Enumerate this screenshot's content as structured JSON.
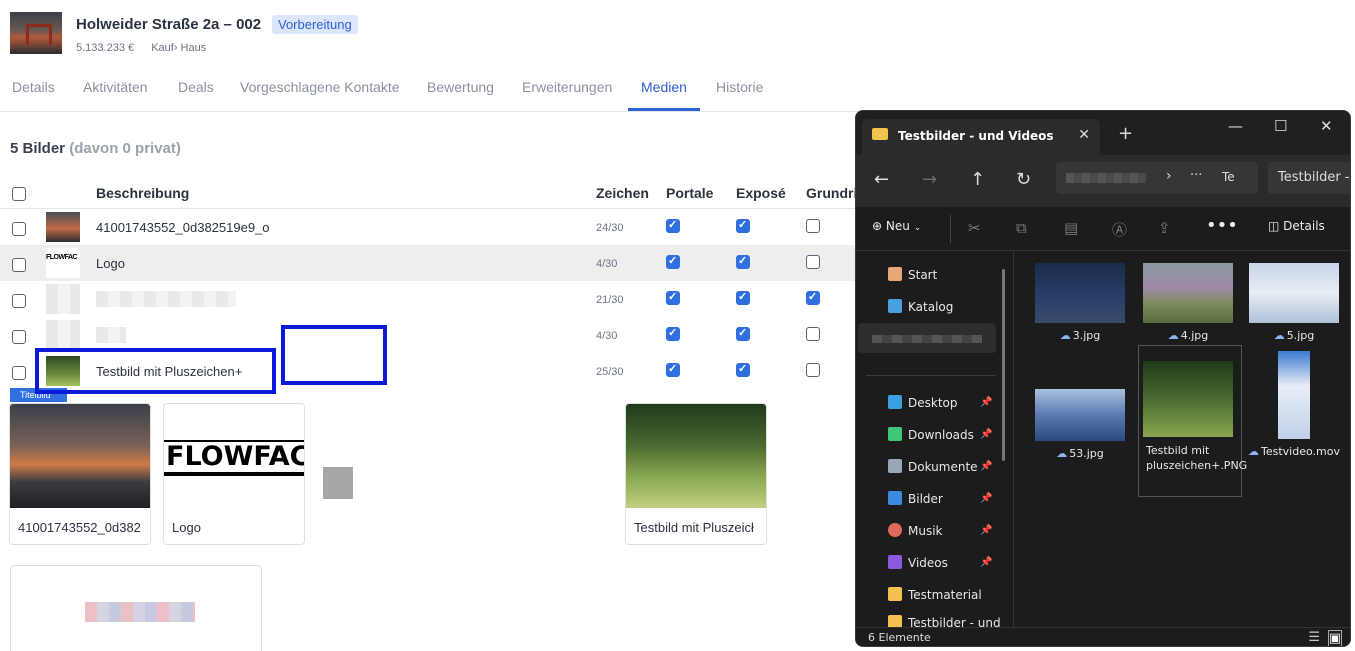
{
  "header": {
    "title": "Holweider Straße 2a – 002",
    "badge": "Vorbereitung",
    "price": "5.133.233 €",
    "type": "Kauf› Haus"
  },
  "tabs": [
    "Details",
    "Aktivitäten",
    "Deals",
    "Vorgeschlagene Kontakte",
    "Bewertung",
    "Erweiterungen",
    "Medien",
    "Historie"
  ],
  "active_tab": "Medien",
  "media": {
    "count": "5 Bilder",
    "count_note": "(davon 0 privat)",
    "columns": [
      "Beschreibung",
      "Zeichen",
      "Portale",
      "Exposé",
      "Grundris"
    ],
    "rows": [
      {
        "description": "41001743552_0d382519e9_o",
        "chars": "24/30",
        "portale": true,
        "expose": true,
        "grundriss": false
      },
      {
        "description": "Logo",
        "chars": "4/30",
        "portale": true,
        "expose": true,
        "grundriss": false
      },
      {
        "description": "",
        "chars": "21/30",
        "portale": true,
        "expose": true,
        "grundriss": true
      },
      {
        "description": "",
        "chars": "4/30",
        "portale": true,
        "expose": true,
        "grundriss": false
      },
      {
        "description": "Testbild mit Pluszeichen+",
        "chars": "25/30",
        "portale": true,
        "expose": true,
        "grundriss": false
      }
    ],
    "titelbild_tag": "Titelbild",
    "cards": [
      {
        "label": "41001743552_0d382"
      },
      {
        "label": "Logo",
        "logo_text": "FLOWFAC"
      },
      {
        "label": ""
      },
      {
        "label": ""
      },
      {
        "label": "Testbild mit Pluszeicł"
      }
    ]
  },
  "explorer": {
    "tab_title": "Testbilder - und Videos",
    "breadcrumb_tail": "Te",
    "breadcrumb_dots": "···",
    "search_placeholder": "Testbilder -",
    "new_label": "Neu",
    "details_label": "Details",
    "sidebar": [
      {
        "label": "Start",
        "icon": "home-icon",
        "color": "#e8a87c"
      },
      {
        "label": "Katalog",
        "icon": "gallery-icon",
        "color": "#4a9fe0"
      },
      {
        "label": "Desktop",
        "icon": "desktop-icon",
        "color": "#3aa0e0",
        "pinned": true
      },
      {
        "label": "Downloads",
        "icon": "download-icon",
        "color": "#3cc77a",
        "pinned": true
      },
      {
        "label": "Dokumente",
        "icon": "document-icon",
        "color": "#9aa7b8",
        "pinned": true
      },
      {
        "label": "Bilder",
        "icon": "pictures-icon",
        "color": "#3a8ae0",
        "pinned": true
      },
      {
        "label": "Musik",
        "icon": "music-icon",
        "color": "#e06a5a",
        "pinned": true
      },
      {
        "label": "Videos",
        "icon": "video-icon",
        "color": "#8a5ae0",
        "pinned": true
      },
      {
        "label": "Testmaterial",
        "icon": "folder-icon",
        "color": "#f2c14e"
      },
      {
        "label": "Testbilder - und",
        "icon": "folder-icon",
        "color": "#f2c14e"
      }
    ],
    "files": [
      {
        "name": "3.jpg"
      },
      {
        "name": "4.jpg"
      },
      {
        "name": "5.jpg"
      },
      {
        "name": "53.jpg"
      },
      {
        "name": "Testbild mit pluszeichen+.PNG"
      },
      {
        "name": "Testvideo.mov"
      }
    ],
    "status": "6 Elemente"
  },
  "colors": {
    "accent": "#2f5fd0",
    "callout": "#0a1ad8",
    "explorer_bg": "#1c1c1c"
  }
}
